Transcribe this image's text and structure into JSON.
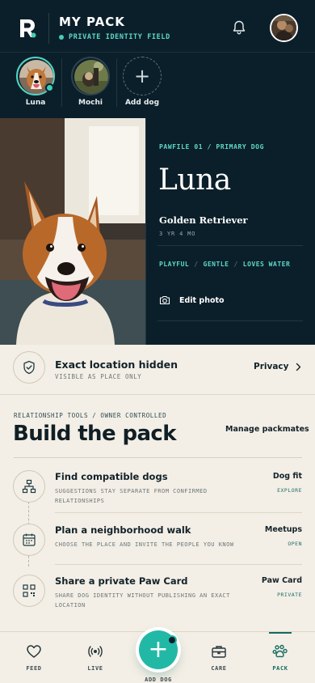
{
  "header": {
    "title": "MY PACK",
    "subtitle": "PRIVATE IDENTITY FIELD"
  },
  "dogs": [
    {
      "name": "Luna",
      "active": true
    },
    {
      "name": "Mochi",
      "active": false
    }
  ],
  "add_dog_label": "Add dog",
  "profile": {
    "eyebrow": "PAWFILE 01 / PRIMARY DOG",
    "name": "Luna",
    "breed": "Golden Retriever",
    "age": "3 YR 4 MO",
    "traits": [
      "PLAYFUL",
      "GENTLE",
      "LOVES WATER"
    ],
    "edit_photo": "Edit photo"
  },
  "privacy": {
    "title": "Exact location hidden",
    "subtitle": "VISIBLE AS PLACE ONLY",
    "link": "Privacy"
  },
  "build": {
    "eyebrow": "RELATIONSHIP TOOLS / OWNER CONTROLLED",
    "title": "Build the pack",
    "manage": "Manage packmates",
    "rows": [
      {
        "title": "Find compatible dogs",
        "desc": "SUGGESTIONS STAY SEPARATE FROM CONFIRMED RELATIONSHIPS",
        "tag": "Dog fit",
        "sub": "EXPLORE",
        "icon": "network-icon"
      },
      {
        "title": "Plan a neighborhood walk",
        "desc": "CHOOSE THE PLACE AND INVITE THE PEOPLE YOU KNOW",
        "tag": "Meetups",
        "sub": "OPEN",
        "icon": "calendar-icon"
      },
      {
        "title": "Share a private Paw Card",
        "desc": "SHARE DOG IDENTITY WITHOUT PUBLISHING AN EXACT LOCATION",
        "tag": "Paw Card",
        "sub": "PRIVATE",
        "icon": "qr-code-icon"
      }
    ]
  },
  "nav": {
    "feed": "FEED",
    "live": "LIVE",
    "add_dog": "ADD DOG",
    "care": "CARE",
    "pack": "PACK",
    "active": "pack"
  },
  "colors": {
    "navy": "#0b1f2a",
    "accent": "#5fd8c6",
    "teal_button": "#21b9a6",
    "cream": "#f3efe6"
  }
}
